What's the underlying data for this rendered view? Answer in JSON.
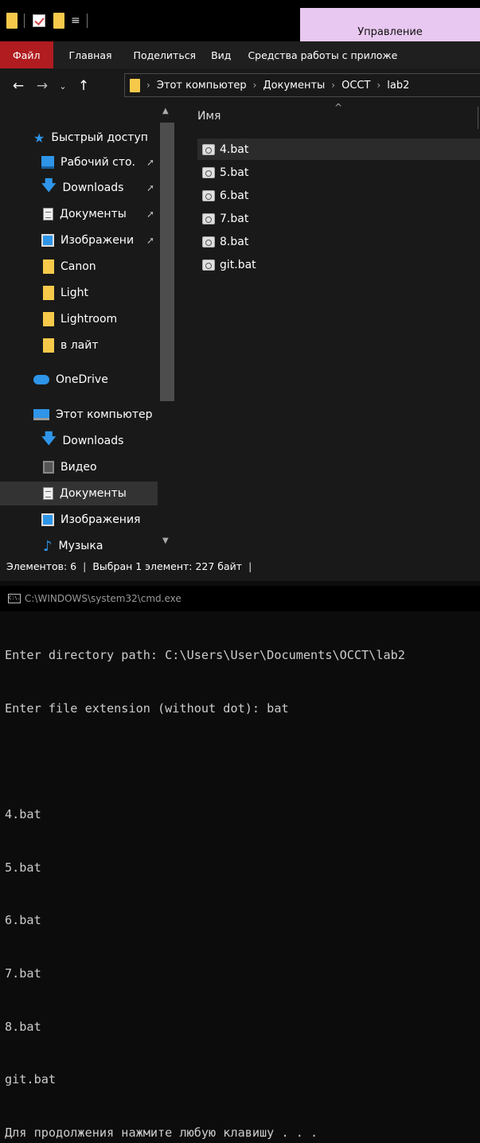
{
  "explorer": {
    "ribbon_context_tab": "Управление",
    "ribbon_tabs": [
      "Файл",
      "Главная",
      "Поделиться",
      "Вид",
      "Средства работы с приложе"
    ],
    "breadcrumbs": [
      "Этот компьютер",
      "Документы",
      "OCCT",
      "lab2"
    ],
    "nav_items": [
      {
        "label": "Быстрый доступ",
        "icon": "star-icon",
        "pinned": false,
        "indent": 0
      },
      {
        "label": "Рабочий сто.",
        "icon": "desktop-icon",
        "pinned": true,
        "indent": 1
      },
      {
        "label": "Downloads",
        "icon": "download-arrow-icon",
        "pinned": true,
        "indent": 1
      },
      {
        "label": "Документы",
        "icon": "document-icon",
        "pinned": true,
        "indent": 1
      },
      {
        "label": "Изображени",
        "icon": "pictures-icon",
        "pinned": true,
        "indent": 1
      },
      {
        "label": "Canon",
        "icon": "folder-icon",
        "pinned": false,
        "indent": 1
      },
      {
        "label": "Light",
        "icon": "folder-icon",
        "pinned": false,
        "indent": 1
      },
      {
        "label": "Lightroom",
        "icon": "folder-icon",
        "pinned": false,
        "indent": 1
      },
      {
        "label": "в лайт",
        "icon": "folder-icon",
        "pinned": false,
        "indent": 1
      },
      {
        "label": "OneDrive",
        "icon": "onedrive-cloud-icon",
        "pinned": false,
        "indent": 0
      },
      {
        "label": "Этот компьютер",
        "icon": "this-pc-icon",
        "pinned": false,
        "indent": 0
      },
      {
        "label": "Downloads",
        "icon": "download-arrow-icon",
        "pinned": false,
        "indent": 1
      },
      {
        "label": "Видео",
        "icon": "video-icon",
        "pinned": false,
        "indent": 1
      },
      {
        "label": "Документы",
        "icon": "document-icon",
        "pinned": false,
        "indent": 1,
        "selected": true
      },
      {
        "label": "Изображения",
        "icon": "pictures-icon",
        "pinned": false,
        "indent": 1
      },
      {
        "label": "Музыка",
        "icon": "music-note-icon",
        "pinned": false,
        "indent": 1
      }
    ],
    "column_name": "Имя",
    "files": [
      "4.bat",
      "5.bat",
      "6.bat",
      "7.bat",
      "8.bat",
      "git.bat"
    ],
    "status": {
      "count": "Элементов: 6",
      "selected": "Выбран 1 элемент: 227 байт"
    }
  },
  "cmd": {
    "title": "C:\\WINDOWS\\system32\\cmd.exe",
    "icon_text": "C:\\.",
    "lines": [
      "Enter directory path: C:\\Users\\User\\Documents\\OCCT\\lab2",
      "Enter file extension (without dot): bat",
      "",
      "4.bat",
      "5.bat",
      "6.bat",
      "7.bat",
      "8.bat",
      "git.bat",
      "Для продолжения нажмите любую клавишу . . ."
    ]
  },
  "colors": {
    "accent_blue": "#2f95e8",
    "file_tab_red": "#b01c20",
    "manage_tab": "#e8c8f0",
    "folder_yellow": "#f6c94a"
  }
}
